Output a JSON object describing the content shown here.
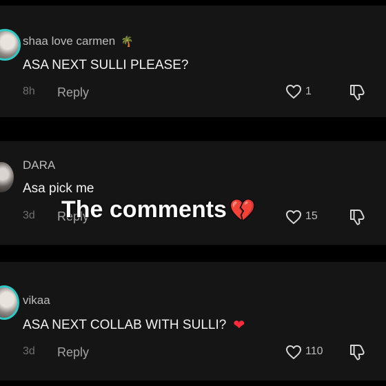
{
  "comments": [
    {
      "username": "shaa love carmen",
      "username_emoji": "🌴",
      "text": "ASA NEXT SULLI PLEASE?",
      "text_emoji": "",
      "time": "8h",
      "reply_label": "Reply",
      "like_count": "1",
      "avatar_ring": true
    },
    {
      "username": "DARA",
      "username_emoji": "",
      "text": "Asa pick me",
      "text_emoji": "",
      "time": "3d",
      "reply_label": "Reply",
      "like_count": "15",
      "avatar_ring": false
    },
    {
      "username": "vikaa",
      "username_emoji": "",
      "text": "ASA NEXT COLLAB WITH SULLI?",
      "text_emoji": "❤",
      "time": "3d",
      "reply_label": "Reply",
      "like_count": "110",
      "avatar_ring": true
    }
  ],
  "overlay": {
    "text": "The comments",
    "emoji": "💔"
  },
  "colors": {
    "background": "#000000",
    "card": "#151515",
    "avatar_ring": "#2fc9c5",
    "heart": "#ff2b3a"
  },
  "icons": {
    "like": "heart-outline-icon",
    "dislike": "thumbs-down-outline-icon"
  }
}
